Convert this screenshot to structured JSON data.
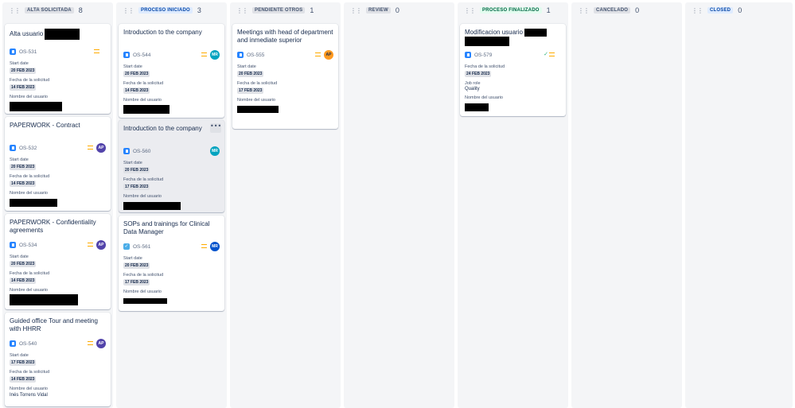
{
  "columns": [
    {
      "title": "ALTA SOLICITADA",
      "count": "8"
    },
    {
      "title": "PROCESO INICIADO",
      "count": "3"
    },
    {
      "title": "PENDIENTE OTROS",
      "count": "1"
    },
    {
      "title": "REVIEW",
      "count": "0"
    },
    {
      "title": "PROCESO FINALIZADO",
      "count": "1"
    },
    {
      "title": "CANCELADO",
      "count": "0"
    },
    {
      "title": "CLOSED",
      "count": "0"
    }
  ],
  "labels": {
    "start_date": "Start date",
    "request_date": "Fecha de la solicitud",
    "user_name": "Nombre del usuario",
    "job_role": "Job role"
  },
  "cards": {
    "c531": {
      "title": "Alta usuario",
      "key": "OS-531",
      "start": "20 FEB 2023",
      "request": "14 FEB 2023"
    },
    "c532": {
      "title": "PAPERWORK - Contract",
      "key": "OS-532",
      "avatar": "AP",
      "start": "20 FEB 2023",
      "request": "14 FEB 2023"
    },
    "c534": {
      "title": "PAPERWORK - Confidentiality agreements",
      "key": "OS-534",
      "avatar": "AP",
      "start": "20 FEB 2023",
      "request": "14 FEB 2023"
    },
    "c540": {
      "title": "Guided office Tour and meeting with HHRR",
      "key": "OS-540",
      "avatar": "AP",
      "start": "17 FEB 2023",
      "request": "14 FEB 2023",
      "user": "Inés Torrens Vidal"
    },
    "c544": {
      "title": "Introduction to the company",
      "key": "OS-544",
      "avatar": "MR",
      "start": "20 FEB 2023",
      "request": "14 FEB 2023"
    },
    "c560": {
      "title": "Introduction to the company",
      "key": "OS-560",
      "avatar": "MR",
      "start": "20 FEB 2023",
      "request": "17 FEB 2023",
      "more": "•••"
    },
    "c561": {
      "title": "SOPs and trainings for Clinical Data Manager",
      "key": "OS-561",
      "avatar": "MR",
      "start": "20 FEB 2023",
      "request": "17 FEB 2023"
    },
    "c555": {
      "title": "Meetings with head of department and inmediate superior",
      "key": "OS-555",
      "avatar": "AP",
      "start": "20 FEB 2023",
      "request": "17 FEB 2023"
    },
    "c579": {
      "title": "Modificacion usuario",
      "key": "OS-579",
      "check": "✓",
      "request": "24 FEB 2023",
      "job_role": "Quality"
    }
  },
  "colors": {
    "priority": "#ffab00",
    "column_bg": "#f4f5f7",
    "card_bg": "#ffffff"
  }
}
